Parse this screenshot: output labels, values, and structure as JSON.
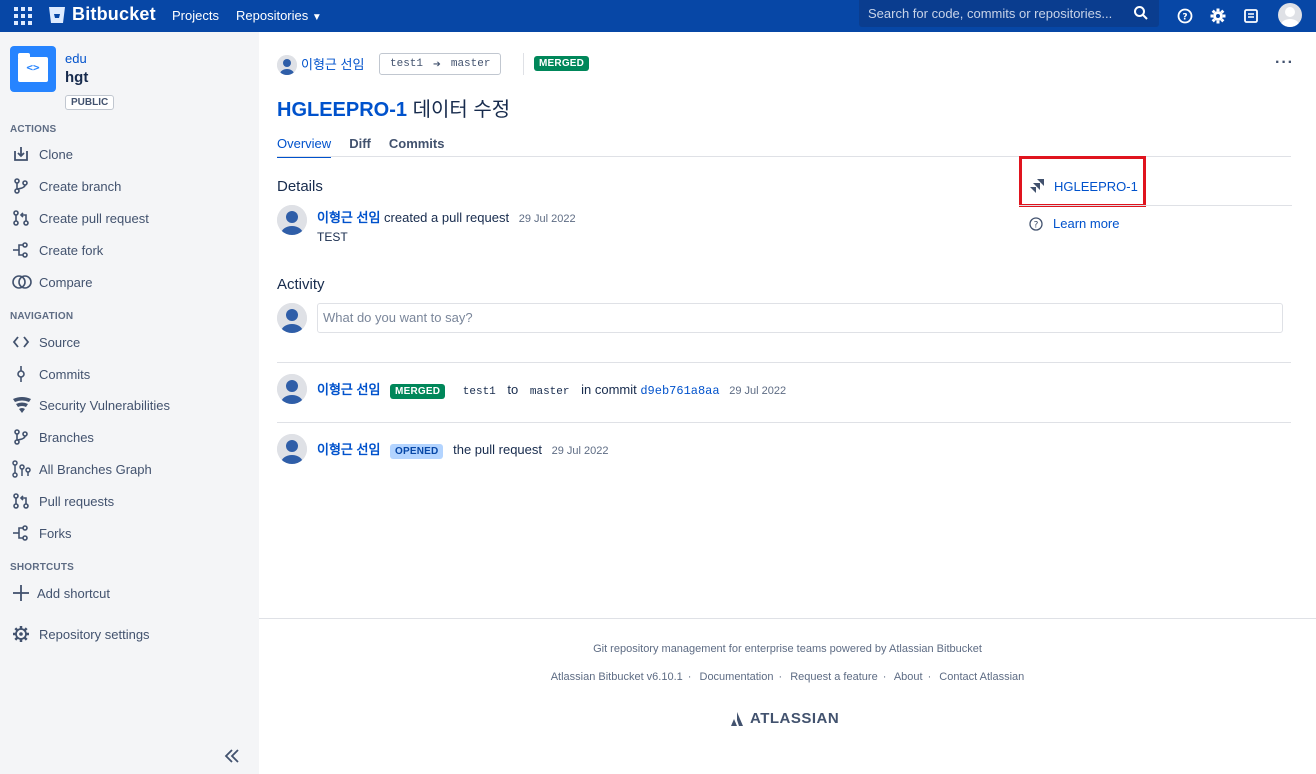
{
  "topbar": {
    "product": "Bitbucket",
    "nav": [
      "Projects",
      "Repositories"
    ],
    "search_placeholder": "Search for code, commits or repositories..."
  },
  "sidebar": {
    "project": "edu",
    "repo": "hgt",
    "visibility": "PUBLIC",
    "actions_title": "ACTIONS",
    "actions": [
      "Clone",
      "Create branch",
      "Create pull request",
      "Create fork",
      "Compare"
    ],
    "navigation_title": "NAVIGATION",
    "navigation": [
      "Source",
      "Commits",
      "Security Vulnerabilities",
      "Branches",
      "All Branches Graph",
      "Pull requests",
      "Forks"
    ],
    "shortcuts_title": "SHORTCUTS",
    "add_shortcut": "Add shortcut",
    "settings": "Repository settings"
  },
  "pr": {
    "author": "이형근 선임",
    "source_branch": "test1",
    "target_branch": "master",
    "status": "MERGED",
    "key": "HGLEEPRO-1",
    "title": "데이터 수정",
    "tabs": [
      "Overview",
      "Diff",
      "Commits"
    ]
  },
  "details": {
    "heading": "Details",
    "author": "이형근 선임",
    "action": "created a pull request",
    "date": "29 Jul 2022",
    "description": "TEST"
  },
  "activity": {
    "heading": "Activity",
    "comment_placeholder": "What do you want to say?",
    "merged": {
      "author": "이형근 선임",
      "badge": "MERGED",
      "from": "test1",
      "to_word": "to",
      "to": "master",
      "in_commit": "in commit",
      "commit": "d9eb761a8aa",
      "date": "29 Jul 2022"
    },
    "opened": {
      "author": "이형근 선임",
      "badge": "OPENED",
      "text": "the pull request",
      "date": "29 Jul 2022"
    }
  },
  "right_panel": {
    "jira_issue": "HGLEEPRO-1",
    "learn_more": "Learn more"
  },
  "footer": {
    "tagline": "Git repository management for enterprise teams powered by Atlassian Bitbucket",
    "links": [
      "Atlassian Bitbucket v6.10.1",
      "Documentation",
      "Request a feature",
      "About",
      "Contact Atlassian"
    ],
    "brand": "ATLASSIAN"
  },
  "colors": {
    "topbar": "#0747a6",
    "link": "#0052cc",
    "merged": "#00875a",
    "opened_bg": "#b3d4ff",
    "highlight": "#e0141e"
  }
}
